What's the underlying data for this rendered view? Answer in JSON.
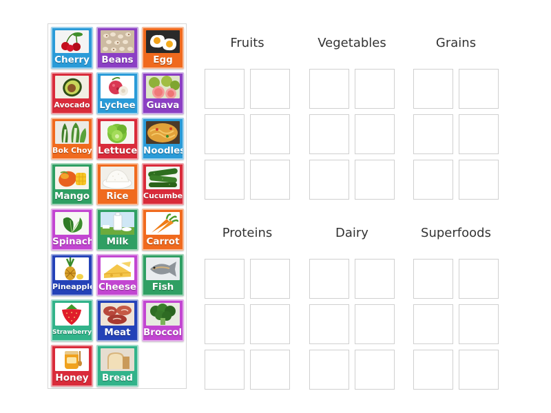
{
  "colors": {
    "blue": "#2a9bd8",
    "purple": "#8b3fc4",
    "orange": "#f06a1e",
    "red": "#d92b3a",
    "green": "#2f9f63",
    "magenta": "#c246d1",
    "navy": "#2442b8",
    "teal": "#32b38a"
  },
  "cards": [
    {
      "label": "Cherry",
      "color": "blue",
      "icon": "cherry-icon",
      "size": ""
    },
    {
      "label": "Beans",
      "color": "purple",
      "icon": "beans-icon",
      "size": ""
    },
    {
      "label": "Egg",
      "color": "orange",
      "icon": "egg-icon",
      "size": ""
    },
    {
      "label": "Avocado",
      "color": "red",
      "icon": "avocado-icon",
      "size": "sm"
    },
    {
      "label": "Lychee",
      "color": "blue",
      "icon": "lychee-icon",
      "size": ""
    },
    {
      "label": "Guava",
      "color": "purple",
      "icon": "guava-icon",
      "size": ""
    },
    {
      "label": "Bok Choy",
      "color": "orange",
      "icon": "bok-choy-icon",
      "size": "sm"
    },
    {
      "label": "Lettuce",
      "color": "red",
      "icon": "lettuce-icon",
      "size": ""
    },
    {
      "label": "Noodles",
      "color": "blue",
      "icon": "noodles-icon",
      "size": ""
    },
    {
      "label": "Mango",
      "color": "green",
      "icon": "mango-icon",
      "size": ""
    },
    {
      "label": "Rice",
      "color": "orange",
      "icon": "rice-icon",
      "size": ""
    },
    {
      "label": "Cucumber",
      "color": "red",
      "icon": "cucumber-icon",
      "size": "sm"
    },
    {
      "label": "Spinach",
      "color": "magenta",
      "icon": "spinach-icon",
      "size": ""
    },
    {
      "label": "Milk",
      "color": "green",
      "icon": "milk-icon",
      "size": ""
    },
    {
      "label": "Carrot",
      "color": "orange",
      "icon": "carrot-icon",
      "size": ""
    },
    {
      "label": "Pineapple",
      "color": "navy",
      "icon": "pineapple-icon",
      "size": "sm"
    },
    {
      "label": "Cheese",
      "color": "magenta",
      "icon": "cheese-icon",
      "size": ""
    },
    {
      "label": "Fish",
      "color": "green",
      "icon": "fish-icon",
      "size": ""
    },
    {
      "label": "Strawberry",
      "color": "teal",
      "icon": "strawberry-icon",
      "size": "xs"
    },
    {
      "label": "Meat",
      "color": "navy",
      "icon": "meat-icon",
      "size": ""
    },
    {
      "label": "Broccoli",
      "color": "magenta",
      "icon": "broccoli-icon",
      "size": ""
    },
    {
      "label": "Honey",
      "color": "red",
      "icon": "honey-icon",
      "size": ""
    },
    {
      "label": "Bread",
      "color": "teal",
      "icon": "bread-icon",
      "size": ""
    }
  ],
  "categories": [
    {
      "title": "Fruits"
    },
    {
      "title": "Vegetables"
    },
    {
      "title": "Grains"
    },
    {
      "title": "Proteins"
    },
    {
      "title": "Dairy"
    },
    {
      "title": "Superfoods"
    }
  ]
}
